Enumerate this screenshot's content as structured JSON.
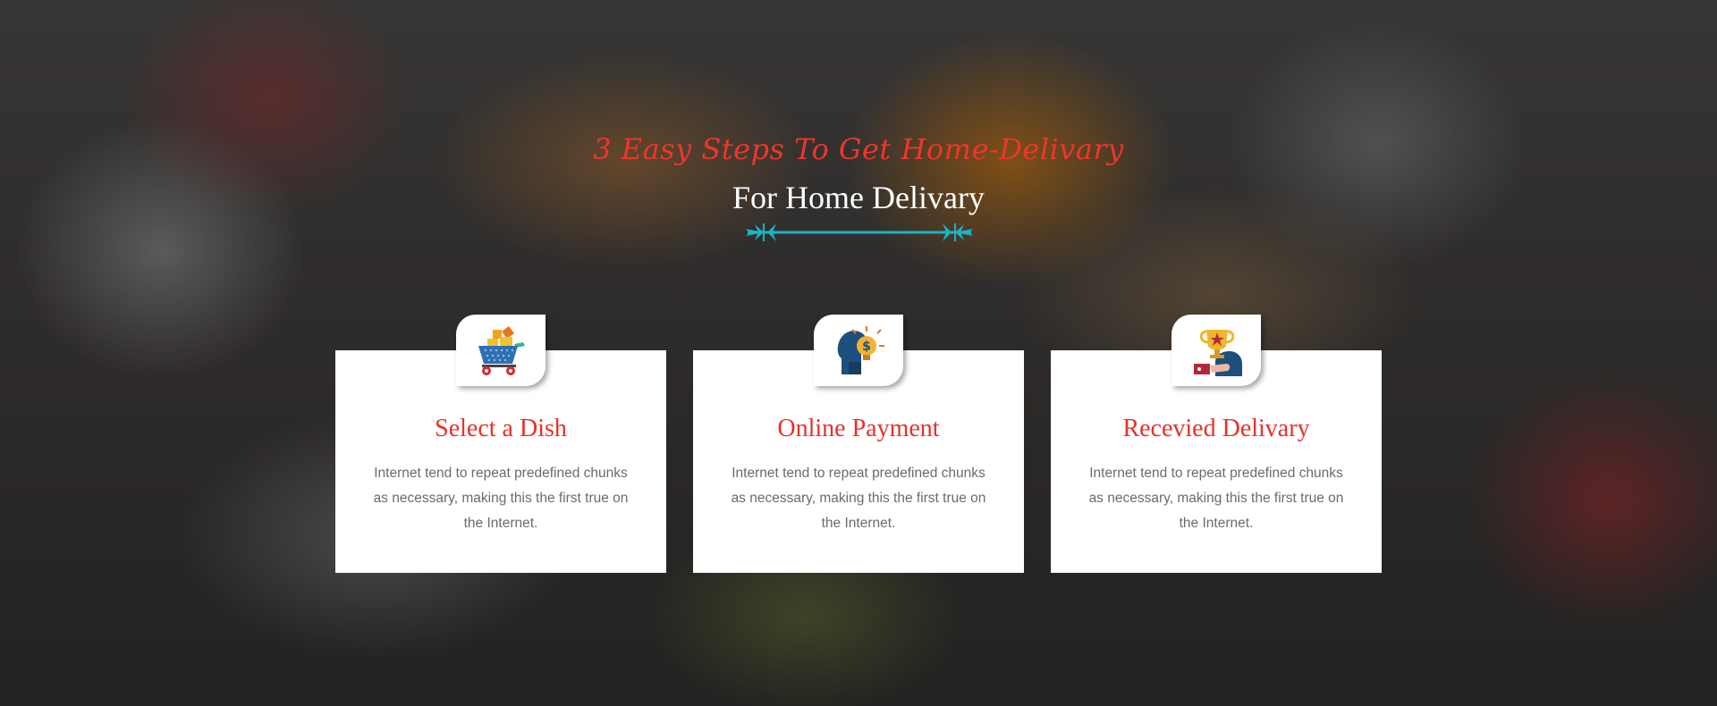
{
  "header": {
    "script_title": "3 Easy Steps To Get Home-Delivary",
    "main_title": "For Home Delivary"
  },
  "colors": {
    "accent_red": "#e8302a",
    "divider_cyan": "#1ab3c4",
    "card_bg": "#ffffff",
    "body_text": "#6b6b6b"
  },
  "steps": [
    {
      "icon": "shopping-cart-icon",
      "title": "Select a Dish",
      "text": "Internet tend to repeat predefined chunks as necessary, making this the first true on the Internet."
    },
    {
      "icon": "idea-payment-icon",
      "title": "Online Payment",
      "text": "Internet tend to repeat predefined chunks as necessary, making this the first true on the Internet."
    },
    {
      "icon": "trophy-award-icon",
      "title": "Recevied Delivary",
      "text": "Internet tend to repeat predefined chunks as necessary, making this the first true on the Internet."
    }
  ]
}
